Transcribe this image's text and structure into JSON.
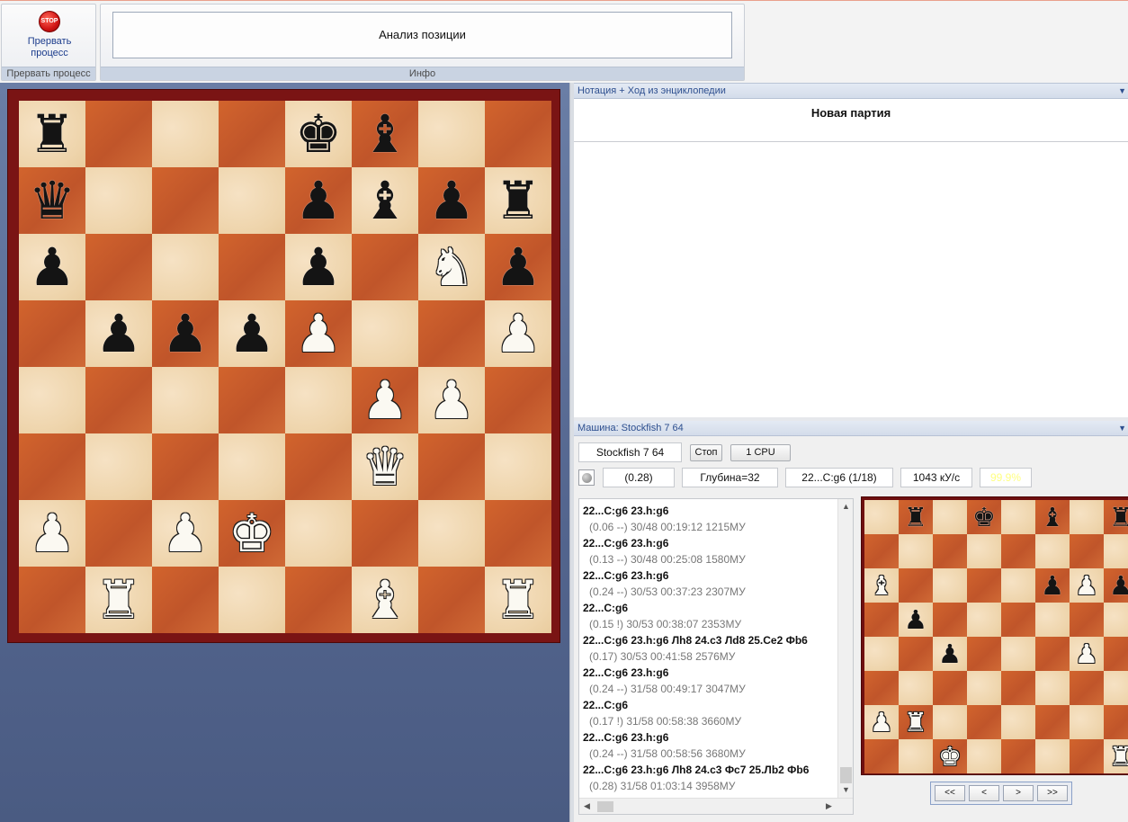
{
  "ribbon": {
    "stop_label": "Прервать процесс",
    "stop_icon_text": "STOP",
    "stop_group_caption": "Прервать процесс",
    "info_text": "Анализ позиции",
    "info_group_caption": "Инфо"
  },
  "notation_panel": {
    "header": "Нотация + Ход из энциклопедии",
    "title": "Новая партия"
  },
  "engine_panel": {
    "header": "Машина: Stockfish 7 64",
    "engine_name": "Stockfish 7 64",
    "stop_button": "Стоп",
    "cpu_button": "1 CPU",
    "evaluation": "(0.28)",
    "depth": "Глубина=32",
    "current_move": "22...С:g6 (1/18)",
    "speed": "1043 кУ/с",
    "tablebase_pct": "99.9%",
    "accent_color": "#ffff80",
    "analysis": [
      {
        "line": "22...С:g6 23.h:g6",
        "stats": "(0.06 --)   30/48   00:19:12  1215МУ"
      },
      {
        "line": "22...С:g6 23.h:g6",
        "stats": "(0.13 --)   30/48   00:25:08  1580МУ"
      },
      {
        "line": "22...С:g6 23.h:g6",
        "stats": "(0.24 --)   30/53   00:37:23  2307МУ"
      },
      {
        "line": "22...С:g6",
        "stats": "(0.15 !)   30/53   00:38:07  2353МУ"
      },
      {
        "line": "22...С:g6 23.h:g6 Лh8 24.c3 Лd8 25.Ce2 Фb6",
        "stats": "(0.17)   30/53   00:41:58  2576МУ"
      },
      {
        "line": "22...С:g6 23.h:g6",
        "stats": "(0.24 --)   31/58   00:49:17  3047МУ"
      },
      {
        "line": "22...С:g6",
        "stats": "(0.17 !)   31/58   00:58:38  3660МУ"
      },
      {
        "line": "22...С:g6 23.h:g6",
        "stats": "(0.24 --)   31/58   00:58:56  3680МУ"
      },
      {
        "line": "22...С:g6 23.h:g6 Лh8 24.c3 Фc7 25.Лb2 Фb6",
        "stats": "(0.28)   31/58   01:03:14  3958МУ"
      }
    ],
    "nav_buttons": [
      "<<",
      "<",
      ">",
      ">>"
    ]
  },
  "main_board": {
    "rows": [
      [
        "bR",
        "",
        "",
        "",
        "bK",
        "bB",
        "",
        ""
      ],
      [
        "bQ",
        "",
        "",
        "",
        "bP",
        "bB",
        "bP",
        "bR"
      ],
      [
        "bP",
        "",
        "",
        "",
        "bP",
        "",
        "wN",
        "bP"
      ],
      [
        "",
        "bP",
        "bP",
        "bP",
        "wP",
        "",
        "",
        "wP"
      ],
      [
        "",
        "",
        "",
        "",
        "",
        "wP",
        "wP",
        ""
      ],
      [
        "",
        "",
        "",
        "",
        "",
        "wQ",
        "",
        ""
      ],
      [
        "wP",
        "",
        "wP",
        "wK",
        "",
        "",
        "",
        ""
      ],
      [
        "",
        "wR",
        "",
        "",
        "",
        "wB",
        "",
        "wR"
      ]
    ]
  },
  "mini_board": {
    "rows": [
      [
        "",
        "bR",
        "",
        "bK",
        "",
        "bB",
        "",
        "bR"
      ],
      [
        "",
        "",
        "",
        "",
        "",
        "",
        "",
        ""
      ],
      [
        "wB",
        "",
        "",
        "",
        "",
        "bP",
        "wP",
        "bP"
      ],
      [
        "",
        "bP",
        "",
        "",
        "",
        "",
        "",
        ""
      ],
      [
        "",
        "",
        "bP",
        "",
        "",
        "",
        "wP",
        ""
      ],
      [
        "",
        "",
        "",
        "",
        "",
        "",
        "",
        ""
      ],
      [
        "wP",
        "wR",
        "",
        "",
        "",
        "",
        "",
        ""
      ],
      [
        "",
        "",
        "wK",
        "",
        "",
        "",
        "",
        "wR"
      ]
    ]
  }
}
